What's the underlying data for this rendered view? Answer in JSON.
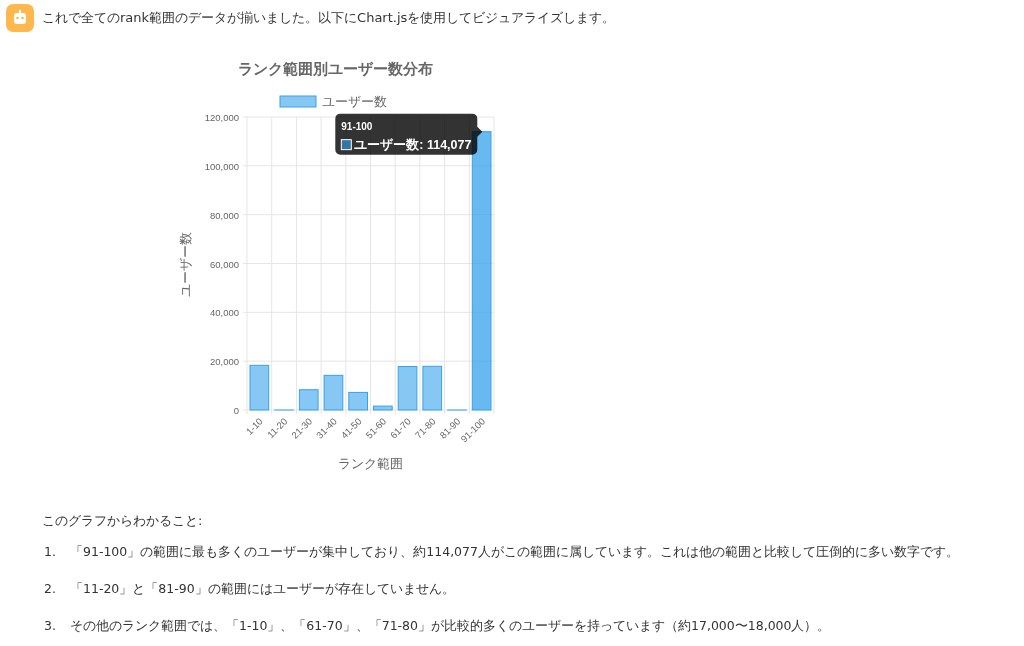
{
  "message": {
    "text": "これで全てのrank範囲のデータが揃いました。以下にChart.jsを使用してビジュアライズします。"
  },
  "chart": {
    "chart_data": {
      "type": "bar",
      "title": "ランク範囲別ユーザー数分布",
      "xlabel": "ランク範囲",
      "ylabel": "ユーザー数",
      "categories": [
        "1-10",
        "11-20",
        "21-30",
        "31-40",
        "41-50",
        "51-60",
        "61-70",
        "71-80",
        "81-90",
        "91-100"
      ],
      "series": [
        {
          "name": "ユーザー数",
          "color": "#36a2eb",
          "values": [
            18300,
            0,
            8300,
            14200,
            7200,
            1600,
            17800,
            17900,
            0,
            114000
          ]
        }
      ],
      "ylim": [
        0,
        120000
      ],
      "yticks": [
        {
          "value": 0,
          "label": "0"
        },
        {
          "value": 20000,
          "label": "20,000"
        },
        {
          "value": 40000,
          "label": "40,000"
        },
        {
          "value": 60000,
          "label": "60,000"
        },
        {
          "value": 80000,
          "label": "80,000"
        },
        {
          "value": 100000,
          "label": "100,000"
        },
        {
          "value": 120000,
          "label": "120,000"
        }
      ],
      "grid": true
    },
    "tooltip": {
      "title": "91-100",
      "label": "ユーザー数: 114,077"
    }
  },
  "summary": {
    "intro": "このグラフからわかること:",
    "items": [
      {
        "number": "1.",
        "text": "「91-100」の範囲に最も多くのユーザーが集中しており、約114,077人がこの範囲に属しています。これは他の範囲と比較して圧倒的に多い数字です。"
      },
      {
        "number": "2.",
        "text": "「11-20」と「81-90」の範囲にはユーザーが存在していません。"
      },
      {
        "number": "3.",
        "text": "その他のランク範囲では、「1-10」、「61-70」、「71-80」が比較的多くのユーザーを持っています（約17,000〜18,000人）。"
      }
    ]
  }
}
